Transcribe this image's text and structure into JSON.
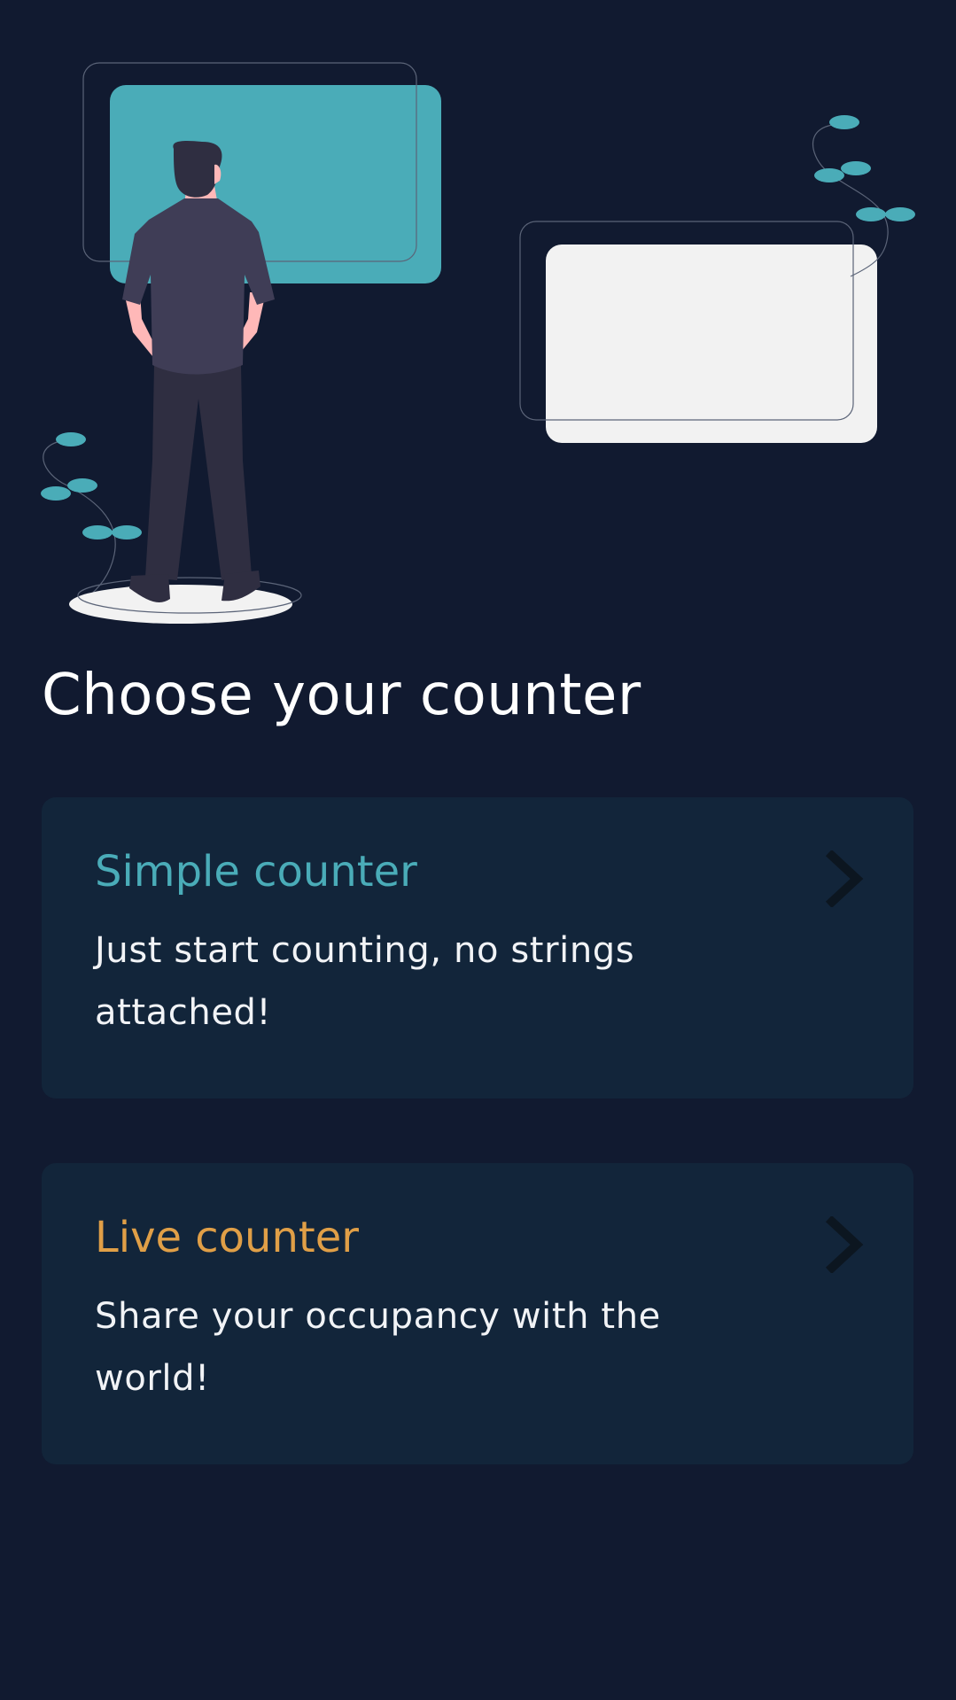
{
  "header": {
    "title": "Choose your counter"
  },
  "counters": [
    {
      "title": "Simple counter",
      "description": "Just start counting, no strings attached!",
      "accent": "#4aacb8",
      "icon": "chevron-right-icon"
    },
    {
      "title": "Live counter",
      "description": "Share your occupancy with the world!",
      "accent": "#e09f47",
      "icon": "chevron-right-icon"
    }
  ],
  "colors": {
    "background": "#111a30",
    "card": "#12253a",
    "teal": "#4aacb8",
    "orange": "#e09f47",
    "screen_light": "#f2f2f2",
    "figure_dark": "#3f3d56"
  }
}
